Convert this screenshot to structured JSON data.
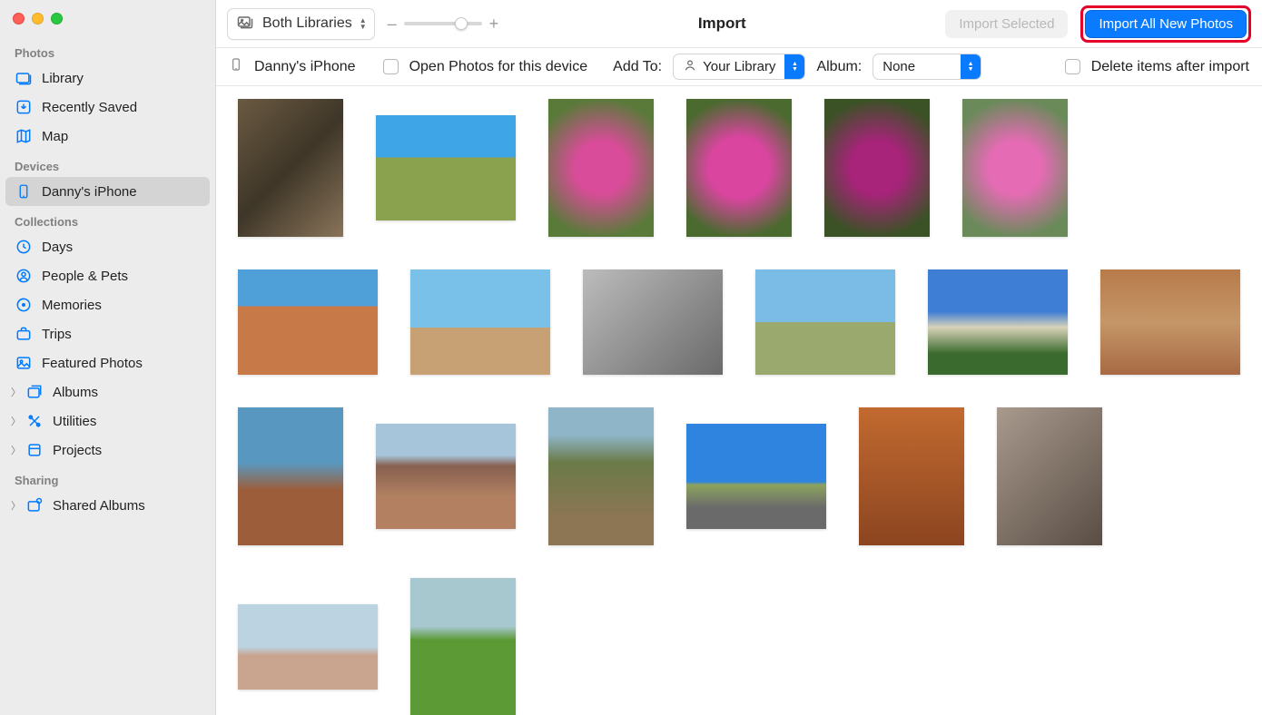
{
  "sidebar": {
    "sections": {
      "photos": {
        "header": "Photos",
        "items": [
          "Library",
          "Recently Saved",
          "Map"
        ]
      },
      "devices": {
        "header": "Devices",
        "items": [
          "Danny's iPhone"
        ]
      },
      "collections": {
        "header": "Collections",
        "items": [
          "Days",
          "People & Pets",
          "Memories",
          "Trips",
          "Featured Photos",
          "Albums",
          "Utilities",
          "Projects"
        ]
      },
      "sharing": {
        "header": "Sharing",
        "items": [
          "Shared Albums"
        ]
      }
    }
  },
  "toolbar": {
    "library_picker": "Both Libraries",
    "zoom_minus": "–",
    "zoom_plus": "+",
    "title": "Import",
    "import_selected": "Import Selected",
    "import_all": "Import All New Photos"
  },
  "subbar": {
    "device_name": "Danny's iPhone",
    "open_photos_label": "Open Photos for this device",
    "add_to_label": "Add To:",
    "add_to_value": "Your Library",
    "album_label": "Album:",
    "album_value": "None",
    "delete_label": "Delete items after import"
  },
  "grid": {
    "photo_count": 20
  }
}
